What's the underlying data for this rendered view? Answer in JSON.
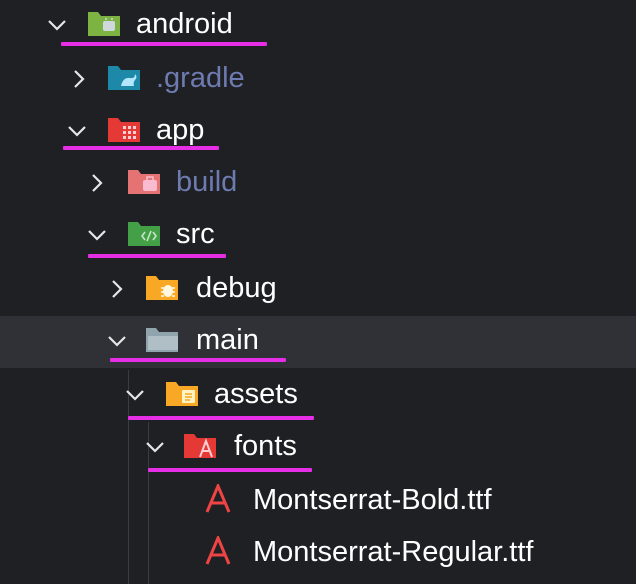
{
  "tree": {
    "android": {
      "label": "android",
      "icon": "android-folder-icon"
    },
    "gradle": {
      "label": ".gradle",
      "icon": "gradle-folder-icon"
    },
    "app": {
      "label": "app",
      "icon": "app-folder-icon"
    },
    "build": {
      "label": "build",
      "icon": "build-folder-icon"
    },
    "src": {
      "label": "src",
      "icon": "src-folder-icon"
    },
    "debug": {
      "label": "debug",
      "icon": "debug-folder-icon"
    },
    "main": {
      "label": "main",
      "icon": "folder-icon"
    },
    "assets": {
      "label": "assets",
      "icon": "assets-folder-icon"
    },
    "fonts": {
      "label": "fonts",
      "icon": "fonts-folder-icon"
    },
    "bold": {
      "label": "Montserrat-Bold.ttf",
      "icon": "font-file-icon"
    },
    "regular": {
      "label": "Montserrat-Regular.ttf",
      "icon": "font-file-icon"
    }
  },
  "colors": {
    "background": "#1f2024",
    "selected_row": "#2f3137",
    "underline": "#e52ee5",
    "muted_text": "#6e7bb0"
  }
}
